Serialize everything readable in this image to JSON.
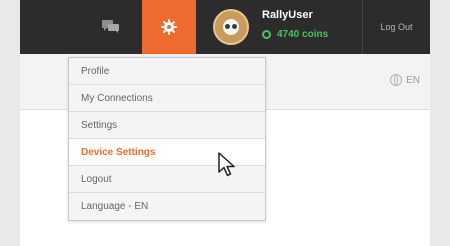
{
  "header": {
    "chat_icon": "chat-bubbles-icon",
    "settings_icon": "gear-icon",
    "user": {
      "avatar": "avatar-icon",
      "username": "RallyUser",
      "coin_icon": "coin-icon",
      "coins": "4740 coins"
    },
    "logout_label": "Log Out"
  },
  "subbar": {
    "language_icon": "globe-icon",
    "language": "EN"
  },
  "dropdown": {
    "items": [
      {
        "label": "Profile"
      },
      {
        "label": "My Connections"
      },
      {
        "label": "Settings"
      },
      {
        "label": "Device Settings",
        "highlight_color": "#ee6a2f"
      },
      {
        "label": "Logout"
      },
      {
        "label": "Language - EN"
      }
    ]
  },
  "colors": {
    "accent": "#ee6a2f",
    "header_bg": "#2c2c2c",
    "coins": "#48c45e"
  },
  "cursor_icon": "mouse-pointer-icon"
}
